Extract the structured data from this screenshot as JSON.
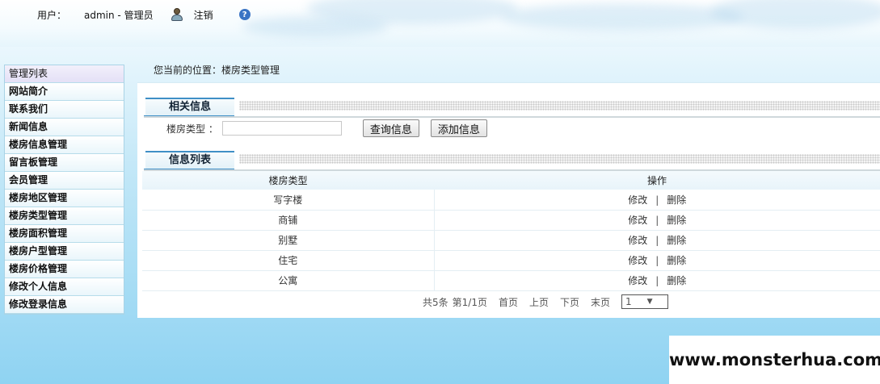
{
  "header": {
    "user_label": "用户：",
    "username": "admin - 管理员",
    "logout": "注销",
    "help": "?"
  },
  "sidebar": {
    "items": [
      {
        "label": "管理列表"
      },
      {
        "label": "网站简介"
      },
      {
        "label": "联系我们"
      },
      {
        "label": "新闻信息"
      },
      {
        "label": "楼房信息管理"
      },
      {
        "label": "留言板管理"
      },
      {
        "label": "会员管理"
      },
      {
        "label": "楼房地区管理"
      },
      {
        "label": "楼房类型管理"
      },
      {
        "label": "楼房面积管理"
      },
      {
        "label": "楼房户型管理"
      },
      {
        "label": "楼房价格管理"
      },
      {
        "label": "修改个人信息"
      },
      {
        "label": "修改登录信息"
      }
    ]
  },
  "breadcrumb": "您当前的位置：楼房类型管理",
  "search_section": {
    "title": "相关信息",
    "field_label": "楼房类型 ：",
    "field_value": "",
    "query_button": "查询信息",
    "add_button": "添加信息"
  },
  "list_section": {
    "title": "信息列表",
    "columns": [
      "楼房类型",
      "操作"
    ],
    "rows": [
      {
        "type": "写字楼",
        "edit": "修改",
        "sep": "|",
        "delete": "删除"
      },
      {
        "type": "商铺",
        "edit": "修改",
        "sep": "|",
        "delete": "删除"
      },
      {
        "type": "别墅",
        "edit": "修改",
        "sep": "|",
        "delete": "删除"
      },
      {
        "type": "住宅",
        "edit": "修改",
        "sep": "|",
        "delete": "删除"
      },
      {
        "type": "公寓",
        "edit": "修改",
        "sep": "|",
        "delete": "删除"
      }
    ]
  },
  "pager": {
    "total": "共5条",
    "page_info": "第1/1页",
    "first": "首页",
    "prev": "上页",
    "next": "下页",
    "last": "末页",
    "current_page": "1",
    "arrow": "▼"
  },
  "watermark": "www.monsterhua.com"
}
